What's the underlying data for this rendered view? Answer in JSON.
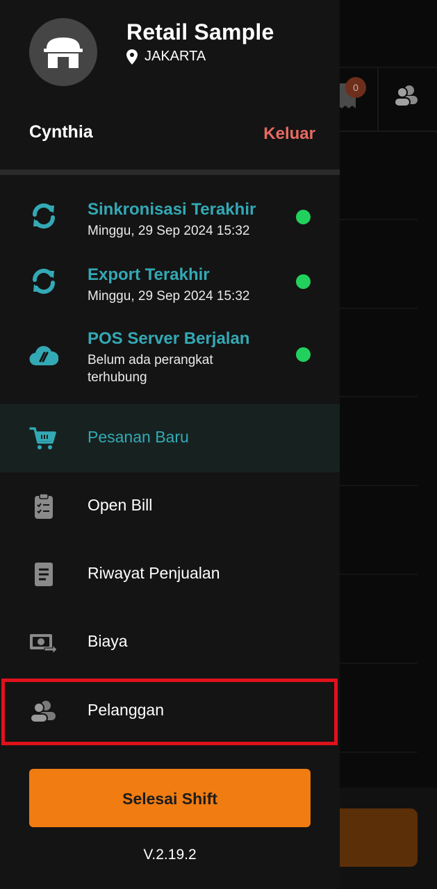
{
  "store": {
    "name": "Retail Sample",
    "location": "JAKARTA",
    "logo_icon": "store-icon"
  },
  "user": {
    "name": "Cynthia",
    "logout_label": "Keluar"
  },
  "status_items": [
    {
      "icon": "sync-icon",
      "title": "Sinkronisasi Terakhir",
      "subtitle": "Minggu, 29 Sep 2024 15:32",
      "status": "online",
      "status_color": "#22d15d"
    },
    {
      "icon": "sync-icon",
      "title": "Export Terakhir",
      "subtitle": "Minggu, 29 Sep 2024 15:32",
      "status": "online",
      "status_color": "#22d15d"
    },
    {
      "icon": "cloud-server-icon",
      "title": "POS Server Berjalan",
      "subtitle": "Belum ada perangkat terhubung",
      "status": "online",
      "status_color": "#22d15d"
    }
  ],
  "menu": [
    {
      "icon": "cart-icon",
      "label": "Pesanan Baru",
      "active": true
    },
    {
      "icon": "clipboard-icon",
      "label": "Open Bill",
      "active": false
    },
    {
      "icon": "document-icon",
      "label": "Riwayat Penjualan",
      "active": false
    },
    {
      "icon": "cash-icon",
      "label": "Biaya",
      "active": false
    },
    {
      "icon": "customers-icon",
      "label": "Pelanggan",
      "active": false,
      "highlighted": true
    }
  ],
  "shift_button_label": "Selesai Shift",
  "version": "V.2.19.2",
  "background": {
    "receipt_badge_count": "0"
  },
  "colors": {
    "accent_teal": "#33a9b5",
    "logout_red": "#e86a62",
    "status_green": "#22d15d",
    "shift_orange": "#f07c12",
    "highlight_red": "#e0121b"
  }
}
